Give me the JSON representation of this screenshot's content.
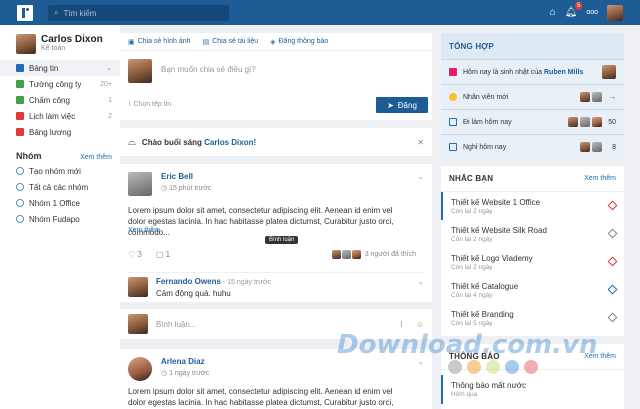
{
  "topbar": {
    "search_placeholder": "Tìm kiếm",
    "notif_count": "5",
    "more": "ooo"
  },
  "profile": {
    "name": "Carlos Dixon",
    "role": "Kế toán"
  },
  "nav": [
    {
      "label": "Bảng tin",
      "count": "",
      "color": "#1e6fb5",
      "active": true
    },
    {
      "label": "Tường công ty",
      "count": "20+",
      "color": "#43a047"
    },
    {
      "label": "Chấm công",
      "count": "1",
      "color": "#43a047"
    },
    {
      "label": "Lịch làm việc",
      "count": "2",
      "color": "#e53935"
    },
    {
      "label": "Bảng lương",
      "count": "",
      "color": "#e53935"
    }
  ],
  "groups": {
    "title": "Nhóm",
    "more": "Xem thêm",
    "items": [
      "Tạo nhóm mới",
      "Tất cả các nhóm",
      "Nhóm 1 Office",
      "Nhóm Fudapo"
    ]
  },
  "composer": {
    "tab_image": "Chia sẻ hình ảnh",
    "tab_doc": "Chia sẻ tài liệu",
    "tab_notice": "Đăng thông báo",
    "placeholder": "Bạn muốn chia sẻ điều gì?",
    "attach": "Chọn tệp tin",
    "post": "Đăng"
  },
  "greeting": {
    "prefix": "Chào buổi sáng ",
    "name": "Carlos Dixon!"
  },
  "post1": {
    "author": "Eric Bell",
    "time": "15 phút trước",
    "body": "Lorem ipsum dolor sit amet, consectetur adipiscing elit. Aenean id enim vel dolor egestas lacinia. In hac habitasse platea dictumst, Curabitur justo orci, commodo...",
    "more": "Xem thêm",
    "tooltip": "Bình luận",
    "likes": "3",
    "comments": "1",
    "liked_by": "3 người đã thích",
    "comment": {
      "author": "Fernando Owens",
      "time": " - 15 ngày trước",
      "text": "Cảm động quá. huhu"
    }
  },
  "comment_box": {
    "placeholder": "Bình luận..."
  },
  "post2": {
    "author": "Arlena Diaz",
    "time": "1 ngày trước",
    "body": "Lorem ipsum dolor sit amet, consectetur adipiscing elit. Aenean id enim vel dolor egestas lacinia. In hac habitasse platea dictumst, Curabitur justo orci, commodo..."
  },
  "summary": {
    "title": "TỔNG HỢP",
    "birthday_prefix": "Hôm nay là sinh nhật của ",
    "birthday_name": "Ruben Mills",
    "rows": [
      {
        "label": "Nhân viên mới",
        "count": "",
        "color": "#fbc02d"
      },
      {
        "label": "Đi làm hôm nay",
        "count": "50",
        "color": "#1e6fb5"
      },
      {
        "label": "Nghỉ hôm nay",
        "count": "8",
        "color": "#1e6fb5"
      }
    ]
  },
  "reminders": {
    "title": "NHẮC BẠN",
    "more": "Xem thêm",
    "items": [
      {
        "title": "Thiết kế Website 1 Office",
        "date": "Còn lại 2 ngày",
        "color": "#e53935"
      },
      {
        "title": "Thiết kế Website Silk Road",
        "date": "Còn lại 2 ngày",
        "color": "#888"
      },
      {
        "title": "Thiết kế Logo Viademy",
        "date": "Còn lại 2 ngày",
        "color": "#e53935"
      },
      {
        "title": "Thiết kế Catalogue",
        "date": "Còn lại 4 ngày",
        "color": "#1e6fb5"
      },
      {
        "title": "Thiết kế Branding",
        "date": "Còn lại 5 ngày",
        "color": "#888"
      }
    ]
  },
  "notices": {
    "title": "THÔNG BÁO",
    "more": "Xem thêm",
    "item": {
      "title": "Thông báo mất nước",
      "date": "Hôm qua"
    }
  },
  "watermark": "Download.com.vn"
}
